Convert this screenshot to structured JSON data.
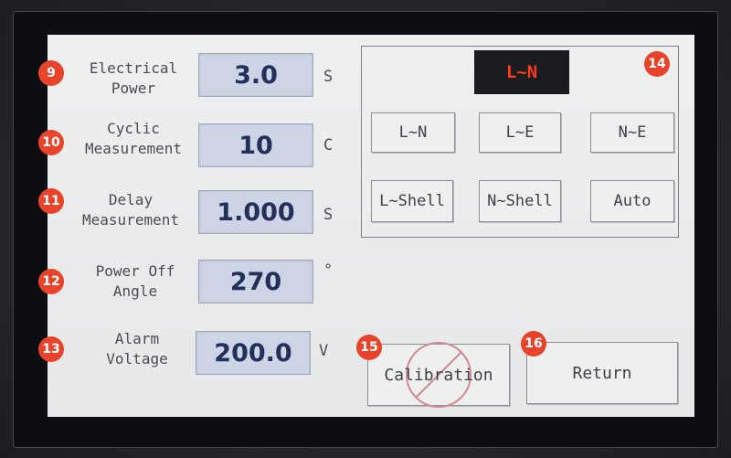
{
  "settings": [
    {
      "label": "Electrical\nPower",
      "value": "3.0",
      "unit": "S",
      "marker": "9"
    },
    {
      "label": "Cyclic\nMeasurement",
      "value": "10",
      "unit": "C",
      "marker": "10"
    },
    {
      "label": "Delay\nMeasurement",
      "value": "1.000",
      "unit": "S",
      "marker": "11"
    },
    {
      "label": "Power Off\nAngle",
      "value": "270",
      "unit": "°",
      "marker": "12"
    },
    {
      "label": "Alarm\nVoltage",
      "value": "200.0",
      "unit": "V",
      "marker": "13"
    }
  ],
  "mode_panel": {
    "current_mode": "L~N",
    "marker": "14",
    "buttons": [
      "L~N",
      "L~E",
      "N~E",
      "L~Shell",
      "N~Shell",
      "Auto"
    ]
  },
  "actions": {
    "calibration_label": "Calibration",
    "calibration_marker": "15",
    "return_label": "Return",
    "return_marker": "16"
  },
  "colors": {
    "marker": "#e8432b",
    "mode_display_text": "#ff3a1e",
    "value_box": "#cdd4e6",
    "screen": "#eef0f0"
  }
}
